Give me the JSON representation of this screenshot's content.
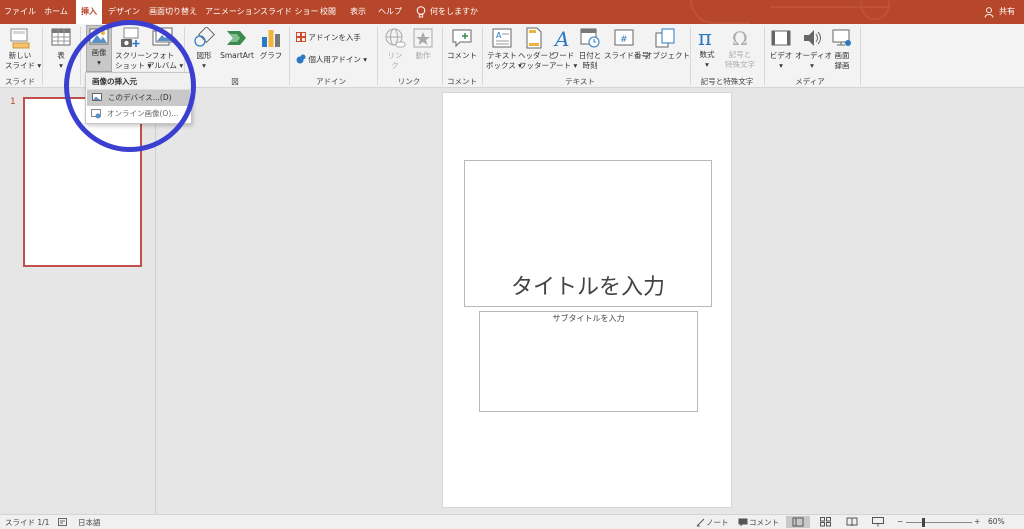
{
  "tabs": [
    "ファイル",
    "ホーム",
    "挿入",
    "デザイン",
    "画面切り替え",
    "アニメーション",
    "スライド ショー",
    "校閲",
    "表示",
    "ヘルプ"
  ],
  "active_tab": "挿入",
  "tell_me": "何をしますか",
  "share": "共有",
  "ribbon": {
    "new_slide": [
      "新しい",
      "スライド"
    ],
    "table": [
      "表"
    ],
    "pictures": [
      "画像"
    ],
    "screenshot": [
      "スクリーン",
      "ショット"
    ],
    "photo_album": [
      "フォト",
      "アルバム"
    ],
    "shapes": [
      "図形"
    ],
    "smartart": "SmartArt",
    "chart": "グラフ",
    "get_addins": "アドインを入手",
    "my_addins": "個人用アドイン",
    "link": [
      "リン",
      "ク"
    ],
    "action": "動作",
    "comment": "コメント",
    "textbox": [
      "テキスト",
      "ボックス"
    ],
    "header_footer": [
      "ヘッダーと",
      "フッター"
    ],
    "wordart": [
      "ワード",
      "アート"
    ],
    "datetime": [
      "日付と",
      "時刻"
    ],
    "slide_number": "スライド番号",
    "object": "オブジェクト",
    "equation": [
      "数式"
    ],
    "symbol": [
      "記号と",
      "特殊文字"
    ],
    "video": [
      "ビデオ"
    ],
    "audio": [
      "オーディオ"
    ],
    "screen_recording": [
      "画面",
      "録画"
    ],
    "groups": {
      "slides": "スライド",
      "images": "図",
      "addins": "アドイン",
      "links": "リンク",
      "comments": "コメント",
      "text": "テキスト",
      "symbols": "記号と特殊文字",
      "media": "メディア"
    }
  },
  "dropdown": {
    "header": "画像の挿入元",
    "items": [
      "このデバイス...(D)",
      "オンライン画像(O)..."
    ]
  },
  "thumb_number": "1",
  "slide": {
    "title_placeholder": "タイトルを入力",
    "subtitle_placeholder": "サブタイトルを入力"
  },
  "status": {
    "slide_info": "スライド 1/1",
    "language": "日本語",
    "notes": "ノート",
    "comments": "コメント",
    "zoom": "60%"
  },
  "colors": {
    "accent": "#b7472a",
    "circle": "#3a3fd0"
  }
}
